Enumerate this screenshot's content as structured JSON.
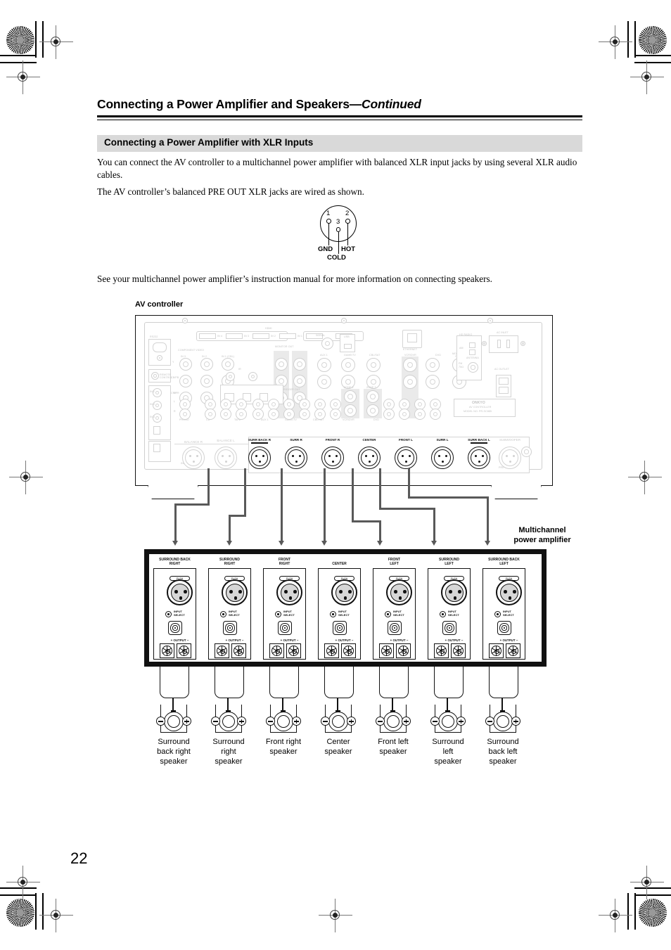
{
  "page": {
    "number": "22",
    "chapter_title": "Connecting a Power Amplifier and Speakers",
    "chapter_title_continued": "—Continued",
    "section_heading": "Connecting a Power Amplifier with XLR Inputs",
    "paragraph_1": "You can connect the AV controller to a multichannel power amplifier with balanced XLR input jacks by using several XLR audio cables.",
    "paragraph_2": "The AV controller’s balanced PRE OUT XLR jacks are wired as shown.",
    "paragraph_3": "See your multichannel power amplifier’s instruction manual for more information on connecting speakers."
  },
  "xlr_pinout": {
    "pin_numbers": [
      "1",
      "2",
      "3"
    ],
    "labels": {
      "pin1": "GND",
      "pin2": "HOT",
      "pin3": "COLD"
    }
  },
  "figure": {
    "av_controller_label": "AV controller",
    "amplifier_label_line1": "Multichannel",
    "amplifier_label_line2": "power amplifier"
  },
  "av_controller": {
    "brand": "ONKYO",
    "device_kind": "AV CONTROLLER",
    "model_text": "MODEL NO. PR-SC885",
    "pre_out_label": "PRE OUT",
    "input_label": "INPUT",
    "balanced_inputs": [
      "BALANCE R",
      "BALANCE L"
    ],
    "subwoofer_label": "SUBWOOFER",
    "xlr_outputs": [
      {
        "label": "SURR BACK R",
        "highlight": true
      },
      {
        "label": "SURR R",
        "highlight": false
      },
      {
        "label": "FRONT R",
        "highlight": false
      },
      {
        "label": "CENTER",
        "highlight": false
      },
      {
        "label": "FRONT L",
        "highlight": false
      },
      {
        "label": "SURR L",
        "highlight": false
      },
      {
        "label": "SURR BACK L",
        "highlight": true
      }
    ],
    "rear_panel_text": [
      "HDMI",
      "IN 4",
      "IN 3",
      "IN 2",
      "IN 1",
      "MONITOR OUT",
      "RS232",
      "COMPONENT VIDEO",
      "IN 3",
      "IN 2",
      "IN 1 (CBL)",
      "MONITOR OUT",
      "SERIAL",
      "USB",
      "ETHERNET",
      "HD RADIO",
      "AM",
      "FM",
      "ANTENNA",
      "AC INLET",
      "AC OUTLET",
      "12V TRIGGER OUT",
      "ZONE 2",
      "ZONE 3",
      "REMOTE CONTROL",
      "PHONO",
      "CD",
      "TAPE",
      "AUX 1",
      "GAME/TV",
      "CBL/SAT",
      "VCR/DVR",
      "DVD",
      "IR",
      "L",
      "R",
      "OUT",
      "IN",
      "AC 120V ~ 60Hz",
      "SWITCHED 120W 1A MAX."
    ]
  },
  "power_amplifier": {
    "push_label": "PUSH",
    "input_select_line1": "INPUT",
    "input_select_line2": "SELECT",
    "output_label": "OUTPUT",
    "output_plus": "+",
    "output_minus": "−",
    "channels": [
      {
        "name_line1": "SURROUND BACK",
        "name_line2": "RIGHT"
      },
      {
        "name_line1": "SURROUND",
        "name_line2": "RIGHT"
      },
      {
        "name_line1": "FRONT",
        "name_line2": "RIGHT"
      },
      {
        "name_line1": "CENTER",
        "name_line2": ""
      },
      {
        "name_line1": "FRONT",
        "name_line2": "LEFT"
      },
      {
        "name_line1": "SURROUND",
        "name_line2": "LEFT"
      },
      {
        "name_line1": "SURROUND BACK",
        "name_line2": "LEFT"
      }
    ]
  },
  "speakers": [
    {
      "line1": "Surround",
      "line2": "back right",
      "line3": "speaker"
    },
    {
      "line1": "Surround",
      "line2": "right",
      "line3": "speaker"
    },
    {
      "line1": "Front right",
      "line2": "speaker",
      "line3": ""
    },
    {
      "line1": "Center",
      "line2": "speaker",
      "line3": ""
    },
    {
      "line1": "Front left",
      "line2": "speaker",
      "line3": ""
    },
    {
      "line1": "Surround",
      "line2": "left",
      "line3": "speaker"
    },
    {
      "line1": "Surround",
      "line2": "back left",
      "line3": "speaker"
    }
  ],
  "colors": {
    "ink": "#000000",
    "section_bar": "#d9d9d9",
    "cable": "#595959",
    "ghost_line": "#d2d2d2",
    "xlr_fill": "#d7d7d7"
  }
}
